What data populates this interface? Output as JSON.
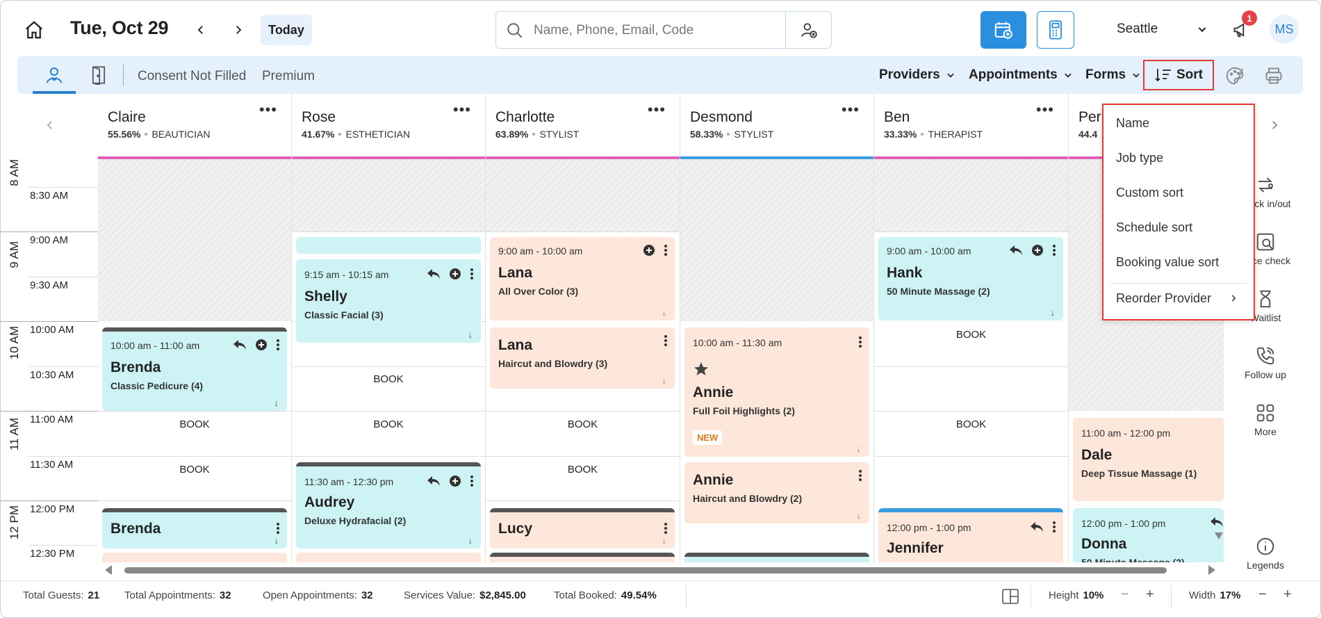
{
  "header": {
    "date": "Tue, Oct 29",
    "today_label": "Today",
    "search_placeholder": "Name, Phone, Email, Code",
    "location": "Seattle",
    "notification_count": "1",
    "user_initials": "MS"
  },
  "toolbar": {
    "consent_label": "Consent Not Filled",
    "premium_label": "Premium",
    "providers_label": "Providers",
    "appointments_label": "Appointments",
    "forms_label": "Forms",
    "sort_label": "Sort"
  },
  "providers": [
    {
      "name": "Claire",
      "pct": "55.56%",
      "role": "BEAUTICIAN",
      "color": "#e05fb8"
    },
    {
      "name": "Rose",
      "pct": "41.67%",
      "role": "ESTHETICIAN",
      "color": "#e05fb8"
    },
    {
      "name": "Charlotte",
      "pct": "63.89%",
      "role": "STYLIST",
      "color": "#e05fb8"
    },
    {
      "name": "Desmond",
      "pct": "58.33%",
      "role": "STYLIST",
      "color": "#3b9be0"
    },
    {
      "name": "Ben",
      "pct": "33.33%",
      "role": "THERAPIST",
      "color": "#e05fb8"
    },
    {
      "name": "Per",
      "pct": "44.4",
      "role": "",
      "color": "#e05fb8"
    }
  ],
  "times": {
    "hours": [
      "8 AM",
      "9 AM",
      "10 AM",
      "11 AM",
      "12 PM"
    ],
    "slots": [
      "8:30 AM",
      "9:00 AM",
      "9:30 AM",
      "10:00 AM",
      "10:30 AM",
      "11:00 AM",
      "11:30 AM",
      "12:00 PM",
      "12:30 PM"
    ]
  },
  "book_label": "BOOK",
  "appointments": {
    "claire_1": {
      "time": "10:00 am - 11:00 am",
      "client": "Brenda",
      "service": "Classic Pedicure (4)"
    },
    "claire_2": {
      "client": "Brenda"
    },
    "rose_1": {
      "time": "9:15 am - 10:15 am",
      "client": "Shelly",
      "service": "Classic Facial (3)"
    },
    "rose_2": {
      "time": "11:30 am - 12:30 pm",
      "client": "Audrey",
      "service": "Deluxe Hydrafacial (2)"
    },
    "charlotte_1": {
      "time": "9:00 am - 10:00 am",
      "client": "Lana",
      "service": "All Over Color (3)"
    },
    "charlotte_2": {
      "client": "Lana",
      "service": "Haircut and Blowdry (3)"
    },
    "charlotte_3": {
      "client": "Lucy"
    },
    "desmond_1": {
      "time": "10:00 am - 11:30 am",
      "client": "Annie",
      "service": "Full Foil Highlights (2)",
      "badge": "NEW"
    },
    "desmond_2": {
      "client": "Annie",
      "service": "Haircut and Blowdry (2)"
    },
    "ben_1": {
      "time": "9:00 am - 10:00 am",
      "client": "Hank",
      "service": "50 Minute Massage (2)"
    },
    "ben_2": {
      "time": "12:00 pm - 1:00 pm",
      "client": "Jennifer"
    },
    "per_1": {
      "time": "11:00 am - 12:00 pm",
      "client": "Dale",
      "service": "Deep Tissue Massage (1)"
    },
    "per_2": {
      "time": "12:00 pm - 1:00 pm",
      "client": "Donna",
      "service": "50 Minute Massage (2)"
    }
  },
  "sort_menu": {
    "items": [
      "Name",
      "Job type",
      "Custom sort",
      "Schedule sort",
      "Booking value sort"
    ],
    "reorder_label": "Reorder Provider"
  },
  "rail": {
    "clock_label": "Clock in/out",
    "price_label": "Price check",
    "waitlist_label": "Waitlist",
    "followup_label": "Follow up",
    "more_label": "More",
    "legends_label": "Legends"
  },
  "footer": {
    "guests_label": "Total Guests:",
    "guests_value": "21",
    "appts_label": "Total Appointments:",
    "appts_value": "32",
    "open_label": "Open Appointments:",
    "open_value": "32",
    "services_label": "Services Value:",
    "services_value": "$2,845.00",
    "booked_label": "Total Booked:",
    "booked_value": "49.54%",
    "height_label": "Height",
    "height_value": "10%",
    "width_label": "Width",
    "width_value": "17%"
  },
  "colors": {
    "accent": "#2b8fe0",
    "appt_cyan": "#cdf3f5",
    "appt_peach": "#fde7da",
    "highlight_red": "#e53935"
  }
}
